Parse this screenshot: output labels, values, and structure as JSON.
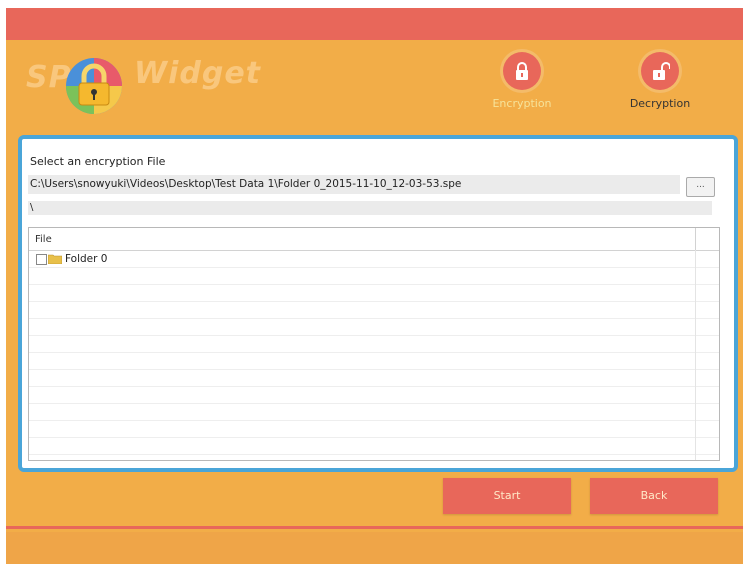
{
  "app": {
    "logo_left": "SP",
    "logo_right": "Widget"
  },
  "modes": [
    {
      "label": "Encryption",
      "icon": "lock-closed-icon",
      "active": true
    },
    {
      "label": "Decryption",
      "icon": "lock-open-icon",
      "active": false
    }
  ],
  "file_select": {
    "label": "Select an encryption File",
    "path": "C:\\Users\\snowyuki\\Videos\\Desktop\\Test Data 1\\Folder 0_2015-11-10_12-03-53.spe",
    "browse_label": "...",
    "subpath": "\\"
  },
  "file_list": {
    "column_header": "File",
    "items": [
      {
        "name": "Folder 0",
        "checked": false,
        "icon": "folder-icon"
      }
    ]
  },
  "actions": {
    "start_label": "Start",
    "back_label": "Back"
  },
  "colors": {
    "background": "#f2ad48",
    "accent": "#e8675a",
    "panel_border": "#4aa5d8",
    "active_mode_text": "#f6e39a"
  }
}
